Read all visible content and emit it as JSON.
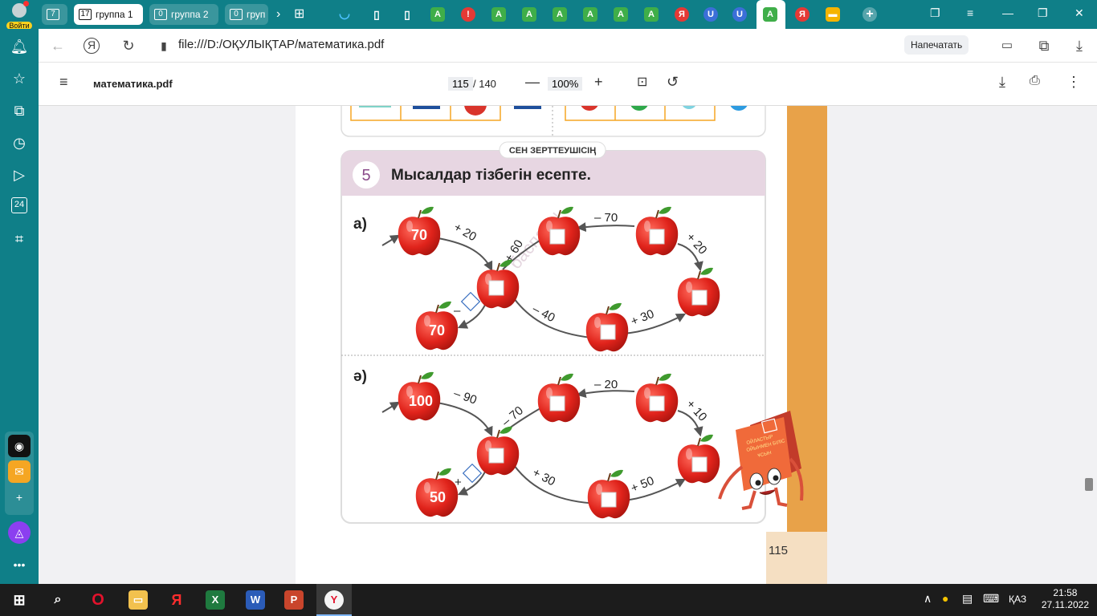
{
  "browser": {
    "login_label": "Войти",
    "tabs": [
      {
        "count": "7",
        "label": ""
      },
      {
        "count": "17",
        "label": "группа 1"
      },
      {
        "count": "0",
        "label": "группа 2"
      },
      {
        "count": "0",
        "label": "груп"
      }
    ],
    "url": "file:///D:/ОҚУЛЫҚТАР/математика.pdf",
    "print_label": "Напечатать"
  },
  "pdf": {
    "title": "математика.pdf",
    "page_current": "115",
    "page_total": "/ 140",
    "zoom": "100%"
  },
  "sidebar": {
    "badge_24": "24"
  },
  "document": {
    "section_tag": "СЕН ЗЕРТТЕУШІСІҢ",
    "task_number": "5",
    "task_title": "Мысалдар тізбегін есепте.",
    "watermark": "баспасы",
    "page_number": "115",
    "mascot_text": [
      "ОЙЛАСТЫР",
      "ОЙЫНМЕН БІЛІС",
      "ҰСЫН"
    ],
    "part_a": {
      "label": "а)",
      "start": "70",
      "end": "70",
      "ops": {
        "op1": "+ 20",
        "op2": "+ 60",
        "op3": "– 70",
        "op4": "+ 20",
        "op5": "– 40",
        "op6": "+ 30",
        "op7": "–"
      }
    },
    "part_b": {
      "label": "ә)",
      "start": "100",
      "end": "50",
      "ops": {
        "op1": "– 90",
        "op2": "– 70",
        "op3": "– 20",
        "op4": "+ 10",
        "op5": "+ 30",
        "op6": "+ 50",
        "op7": "+"
      }
    }
  },
  "taskbar": {
    "lang": "ҚАЗ",
    "time": "21:58",
    "date": "27.11.2022"
  }
}
